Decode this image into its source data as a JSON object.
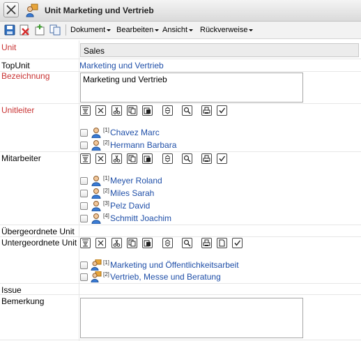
{
  "window": {
    "title": "Unit Marketing und Vertrieb"
  },
  "toolbar": {
    "icons": [
      "save-icon",
      "delete-icon",
      "new-icon",
      "copy-icon"
    ],
    "menus": [
      "Dokument",
      "Bearbeiten",
      "Ansicht",
      "Rückverweise"
    ]
  },
  "form": {
    "unit_label": "Unit",
    "unit_value": "Sales",
    "topunit_label": "TopUnit",
    "topunit_value": "Marketing und Vertrieb",
    "bezeichnung_label": "Bezeichnung",
    "bezeichnung_value": "Marketing und Vertrieb",
    "unitleiter_label": "Unitleiter",
    "unitleiter": [
      {
        "num": "[1]",
        "name": "Chavez Marc"
      },
      {
        "num": "[2]",
        "name": "Hermann Barbara"
      }
    ],
    "mitarbeiter_label": "Mitarbeiter",
    "mitarbeiter": [
      {
        "num": "[1]",
        "name": "Meyer Roland"
      },
      {
        "num": "[2]",
        "name": "Miles Sarah"
      },
      {
        "num": "[3]",
        "name": "Pelz David"
      },
      {
        "num": "[4]",
        "name": "Schmitt Joachim"
      }
    ],
    "uebergeordnete_label": "Übergeordnete Unit",
    "untergeordnete_label": "Untergeordnete Unit",
    "untergeordnete": [
      {
        "num": "[1]",
        "name": "Marketing und Öffentlichkeitsarbeit"
      },
      {
        "num": "[2]",
        "name": "Vertrieb, Messe und Beratung"
      }
    ],
    "issue_label": "Issue",
    "bemerkung_label": "Bemerkung",
    "bemerkung_value": ""
  },
  "colors": {
    "required_label": "#c83232",
    "link": "#1f4fa8"
  }
}
